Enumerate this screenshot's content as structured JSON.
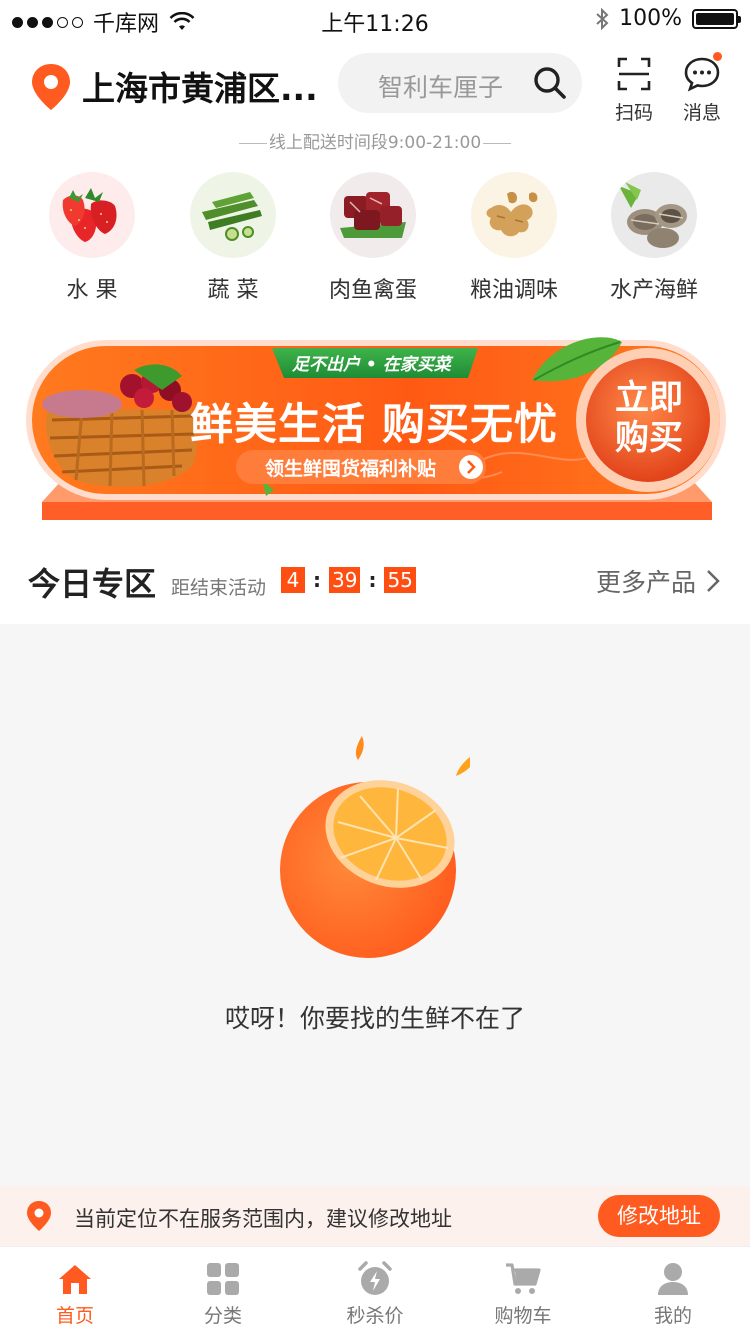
{
  "status_bar": {
    "carrier": "千库网",
    "time": "上午11:26",
    "battery": "100%",
    "battery_level": 1.0
  },
  "header": {
    "location": "上海市黄浦区...",
    "search_placeholder": "智利车厘子",
    "scan_label": "扫码",
    "message_label": "消息",
    "has_unread": true
  },
  "delivery_note": "线上配送时间段9:00-21:00",
  "categories": [
    {
      "label": "水 果",
      "icon": "strawberry-icon"
    },
    {
      "label": "蔬 菜",
      "icon": "okra-icon"
    },
    {
      "label": "肉鱼禽蛋",
      "icon": "meat-icon"
    },
    {
      "label": "粮油调味",
      "icon": "ginger-icon"
    },
    {
      "label": "水产海鲜",
      "icon": "clam-icon"
    }
  ],
  "banner": {
    "tag": "足不出户 • 在家买菜",
    "headline": "鲜美生活 购买无忧",
    "subline": "领生鲜囤货福利补贴",
    "cta_line1": "立即",
    "cta_line2": "购买"
  },
  "today": {
    "title": "今日专区",
    "subtitle": "距结束活动",
    "countdown": {
      "h": "4",
      "m": "39",
      "s": "55"
    },
    "more": "更多产品"
  },
  "empty_state": {
    "message": "哎呀！你要找的生鲜不在了",
    "icon": "orange-icon"
  },
  "location_warning": {
    "text": "当前定位不在服务范围内，建议修改地址",
    "button": "修改地址"
  },
  "tabs": [
    {
      "label": "首页",
      "icon": "home-icon",
      "active": true
    },
    {
      "label": "分类",
      "icon": "category-icon",
      "active": false
    },
    {
      "label": "秒杀价",
      "icon": "alarm-icon",
      "active": false
    },
    {
      "label": "购物车",
      "icon": "cart-icon",
      "active": false
    },
    {
      "label": "我的",
      "icon": "user-icon",
      "active": false
    }
  ],
  "colors": {
    "accent": "#ff5a1f",
    "countdown_bg": "#ff4e12",
    "banner_orange": "#ff6a1a",
    "empty_bg": "#f6f6f6",
    "warning_bg": "#fdf1ed"
  }
}
